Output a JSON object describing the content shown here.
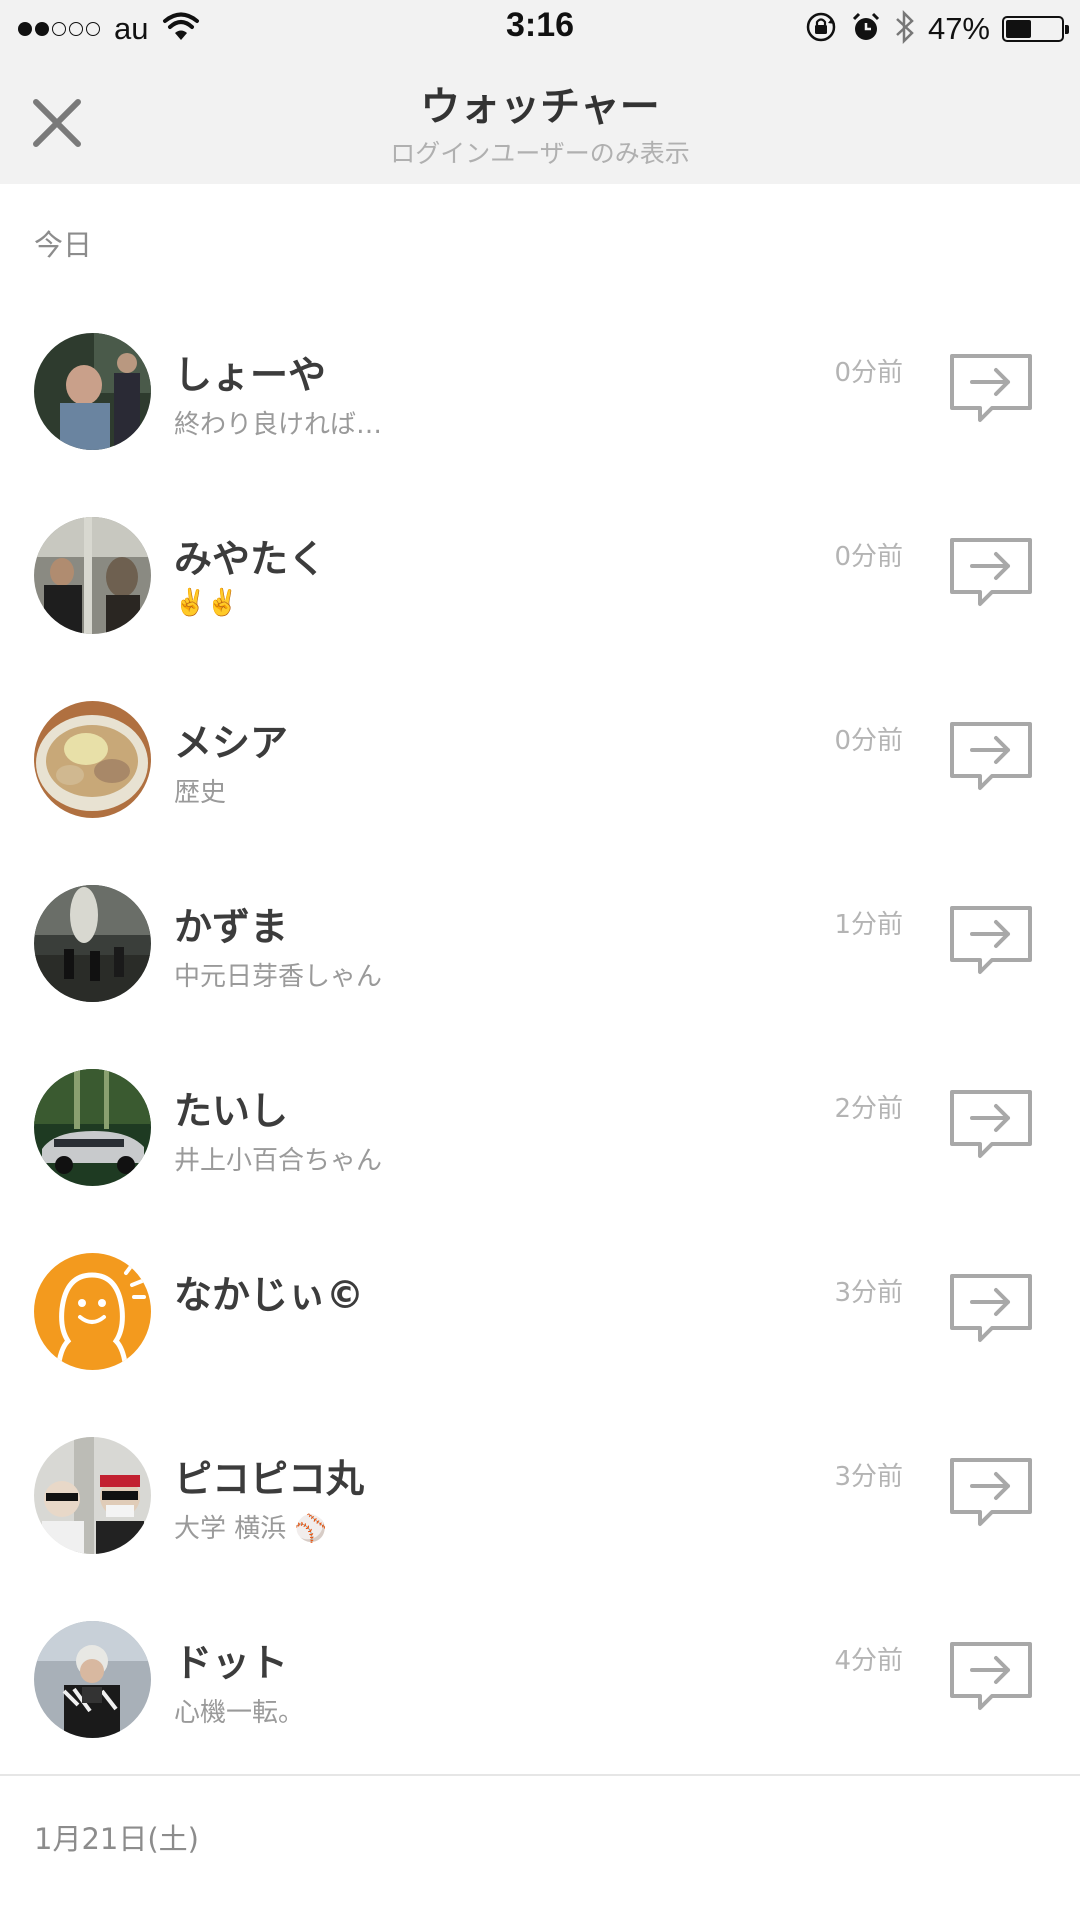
{
  "status_bar": {
    "carrier": "au",
    "time": "3:16",
    "battery_percent": "47%",
    "battery_level": 0.47,
    "signal_bars_filled": 2,
    "signal_bars_total": 5
  },
  "header": {
    "title": "ウォッチャー",
    "subtitle": "ログインユーザーのみ表示",
    "close_icon": "close-icon"
  },
  "sections": {
    "today_label": "今日",
    "previous_label": "1月21日(土)"
  },
  "colors": {
    "header_bg": "#f2f2f2",
    "default_avatar": "#f39a1e",
    "time_text": "#b4b4b4",
    "icon_gray": "#a8a8a8"
  },
  "watchers": [
    {
      "name": "しょーや",
      "status": "終わり良ければ…",
      "time": "0分前"
    },
    {
      "name": "みやたく",
      "status": "✌️✌️",
      "time": "0分前"
    },
    {
      "name": "メシア",
      "status": "歴史",
      "time": "0分前"
    },
    {
      "name": "かずま",
      "status": "中元日芽香しゃん",
      "time": "1分前"
    },
    {
      "name": "たいし",
      "status": "井上小百合ちゃん",
      "time": "2分前"
    },
    {
      "name": "なかじぃ©",
      "status": "",
      "time": "3分前"
    },
    {
      "name": "ピコピコ丸",
      "status": "大学 横浜 ⚾",
      "time": "3分前"
    },
    {
      "name": "ドット",
      "status": "心機一転。",
      "time": "4分前"
    }
  ]
}
